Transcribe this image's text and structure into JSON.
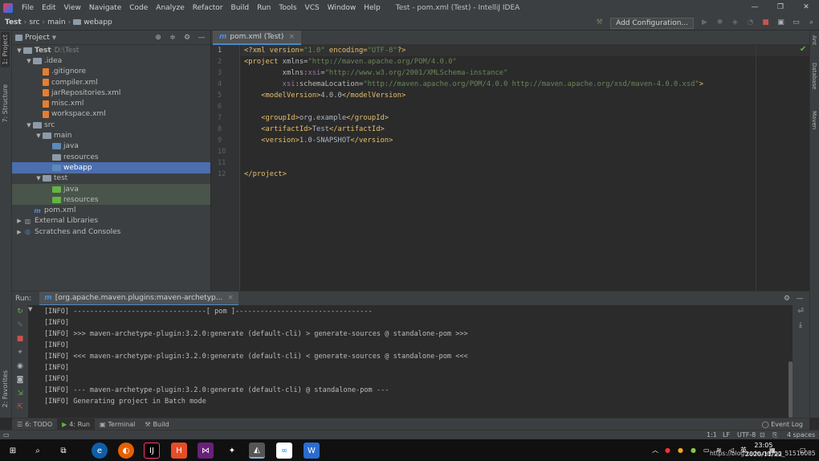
{
  "window": {
    "title": "Test - pom.xml (Test) - IntelliJ IDEA",
    "menu": [
      "File",
      "Edit",
      "View",
      "Navigate",
      "Code",
      "Analyze",
      "Refactor",
      "Build",
      "Run",
      "Tools",
      "VCS",
      "Window",
      "Help"
    ],
    "controls": [
      "—",
      "❐",
      "✕"
    ]
  },
  "navbar": {
    "crumbs": [
      "Test",
      "src",
      "main",
      "webapp"
    ],
    "add_configuration": "Add Configuration..."
  },
  "left_strip": {
    "tabs": [
      "1: Project",
      "7: Structure",
      "2: Favorites"
    ]
  },
  "right_strip": {
    "tabs": [
      "Ant",
      "Database",
      "Maven"
    ]
  },
  "project": {
    "header": "Project",
    "tree": [
      {
        "label": "Test",
        "sub": "D:\\Test",
        "depth": 0,
        "arrow": "▼",
        "icon": "folder-gray",
        "bold": true
      },
      {
        "label": ".idea",
        "depth": 1,
        "arrow": "▼",
        "icon": "folder-gray"
      },
      {
        "label": ".gitignore",
        "depth": 2,
        "arrow": "",
        "icon": "file-xml"
      },
      {
        "label": "compiler.xml",
        "depth": 2,
        "arrow": "",
        "icon": "file-xml"
      },
      {
        "label": "jarRepositories.xml",
        "depth": 2,
        "arrow": "",
        "icon": "file-xml"
      },
      {
        "label": "misc.xml",
        "depth": 2,
        "arrow": "",
        "icon": "file-xml"
      },
      {
        "label": "workspace.xml",
        "depth": 2,
        "arrow": "",
        "icon": "file-xml"
      },
      {
        "label": "src",
        "depth": 1,
        "arrow": "▼",
        "icon": "folder-gray"
      },
      {
        "label": "main",
        "depth": 2,
        "arrow": "▼",
        "icon": "folder-gray"
      },
      {
        "label": "java",
        "depth": 3,
        "arrow": "",
        "icon": "folder-blue"
      },
      {
        "label": "resources",
        "depth": 3,
        "arrow": "",
        "icon": "folder-gray"
      },
      {
        "label": "webapp",
        "depth": 3,
        "arrow": "",
        "icon": "folder-blue",
        "selected": true
      },
      {
        "label": "test",
        "depth": 2,
        "arrow": "▼",
        "icon": "folder-gray"
      },
      {
        "label": "java",
        "depth": 3,
        "arrow": "",
        "icon": "folder-green",
        "test": true
      },
      {
        "label": "resources",
        "depth": 3,
        "arrow": "",
        "icon": "folder-green",
        "test": true
      },
      {
        "label": "pom.xml",
        "depth": 1,
        "arrow": "",
        "icon": "maven"
      },
      {
        "label": "External Libraries",
        "depth": 0,
        "arrow": "▶",
        "icon": "library"
      },
      {
        "label": "Scratches and Consoles",
        "depth": 0,
        "arrow": "▶",
        "icon": "scratch"
      }
    ]
  },
  "editor": {
    "tab": "pom.xml (Test)",
    "line_numbers": [
      "1",
      "2",
      "3",
      "4",
      "5",
      "6",
      "7",
      "8",
      "9",
      "10",
      "11",
      "12"
    ],
    "lines": [
      [
        [
          "<?xml version=",
          "tag"
        ],
        [
          "\"1.0\"",
          "str"
        ],
        [
          " encoding=",
          "tag"
        ],
        [
          "\"UTF-8\"",
          "str"
        ],
        [
          "?>",
          "tag"
        ]
      ],
      [
        [
          "<project ",
          "tag"
        ],
        [
          "xmlns=",
          "att"
        ],
        [
          "\"http://maven.apache.org/POM/4.0.0\"",
          "str"
        ]
      ],
      [
        [
          "         ",
          "txt"
        ],
        [
          "xmlns:",
          "att"
        ],
        [
          "xsi",
          "ns"
        ],
        [
          "=",
          "att"
        ],
        [
          "\"http://www.w3.org/2001/XMLSchema-instance\"",
          "str"
        ]
      ],
      [
        [
          "         ",
          "txt"
        ],
        [
          "xsi",
          "ns"
        ],
        [
          ":schemaLocation=",
          "att"
        ],
        [
          "\"http://maven.apache.org/POM/4.0.0 http://maven.apache.org/xsd/maven-4.0.0.xsd\"",
          "str"
        ],
        [
          ">",
          "tag"
        ]
      ],
      [
        [
          "    ",
          "txt"
        ],
        [
          "<modelVersion>",
          "tag"
        ],
        [
          "4.0.0",
          "txt"
        ],
        [
          "</modelVersion>",
          "tag"
        ]
      ],
      [
        [
          "",
          "txt"
        ]
      ],
      [
        [
          "    ",
          "txt"
        ],
        [
          "<groupId>",
          "tag"
        ],
        [
          "org.example",
          "txt"
        ],
        [
          "</groupId>",
          "tag"
        ]
      ],
      [
        [
          "    ",
          "txt"
        ],
        [
          "<artifactId>",
          "tag"
        ],
        [
          "Test",
          "txt"
        ],
        [
          "</artifactId>",
          "tag"
        ]
      ],
      [
        [
          "    ",
          "txt"
        ],
        [
          "<version>",
          "tag"
        ],
        [
          "1.0-SNAPSHOT",
          "txt"
        ],
        [
          "</version>",
          "tag"
        ]
      ],
      [
        [
          "",
          "txt"
        ]
      ],
      [
        [
          "",
          "txt"
        ]
      ],
      [
        [
          "</project>",
          "tag"
        ]
      ]
    ]
  },
  "run": {
    "label": "Run:",
    "tab": "[org.apache.maven.plugins:maven-archetyp...",
    "console": [
      "[INFO] --------------------------------[ pom ]---------------------------------",
      "[INFO]",
      "[INFO] >>> maven-archetype-plugin:3.2.0:generate (default-cli) > generate-sources @ standalone-pom >>>",
      "[INFO]",
      "[INFO] <<< maven-archetype-plugin:3.2.0:generate (default-cli) < generate-sources @ standalone-pom <<<",
      "[INFO]",
      "[INFO]",
      "[INFO] --- maven-archetype-plugin:3.2.0:generate (default-cli) @ standalone-pom ---",
      "[INFO] Generating project in Batch mode"
    ]
  },
  "tool_windows": {
    "todo": "6: TODO",
    "run": "4: Run",
    "terminal": "Terminal",
    "build": "Build",
    "event_log": "Event Log"
  },
  "status": {
    "position": "1:1",
    "line_sep": "LF",
    "encoding": "UTF-8",
    "indent": "4 spaces"
  },
  "taskbar": {
    "time": "23:05",
    "date": "2020/11/22",
    "url": "https://blog.csdn.net/qq_51516085",
    "lang": "英"
  },
  "colors": {
    "accent": "#4a88c7",
    "selection": "#4b6eaf",
    "ok": "#62b543"
  }
}
